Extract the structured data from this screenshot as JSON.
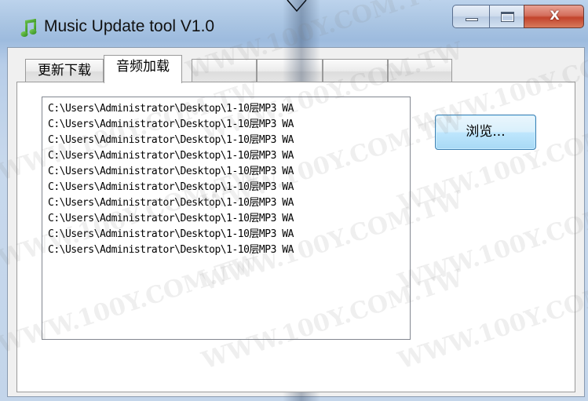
{
  "window": {
    "title": "Music Update tool V1.0",
    "app_icon": "music-note-icon",
    "controls": {
      "minimize": "minimize-icon",
      "maximize": "maximize-icon",
      "close": "close-icon",
      "close_glyph": "X"
    }
  },
  "tabs": [
    {
      "label": "更新下载",
      "active": false
    },
    {
      "label": "音频加载",
      "active": true
    },
    {
      "label": "",
      "active": false
    },
    {
      "label": "",
      "active": false
    },
    {
      "label": "",
      "active": false
    },
    {
      "label": "",
      "active": false
    }
  ],
  "file_list": [
    "C:\\Users\\Administrator\\Desktop\\1-10层MP3 WA",
    "C:\\Users\\Administrator\\Desktop\\1-10层MP3 WA",
    "C:\\Users\\Administrator\\Desktop\\1-10层MP3 WA",
    "C:\\Users\\Administrator\\Desktop\\1-10层MP3 WA",
    "C:\\Users\\Administrator\\Desktop\\1-10层MP3 WA",
    "C:\\Users\\Administrator\\Desktop\\1-10层MP3 WA",
    "C:\\Users\\Administrator\\Desktop\\1-10层MP3 WA",
    "C:\\Users\\Administrator\\Desktop\\1-10层MP3 WA",
    "C:\\Users\\Administrator\\Desktop\\1-10层MP3 WA",
    "C:\\Users\\Administrator\\Desktop\\1-10层MP3 WA"
  ],
  "browse_button": {
    "label": "浏览..."
  },
  "watermark_text": "WWW.100Y.COM.TW",
  "colors": {
    "close_button": "#c2432c",
    "browse_button_border": "#3c7fb1",
    "title_bar": "#a9c4e2"
  }
}
